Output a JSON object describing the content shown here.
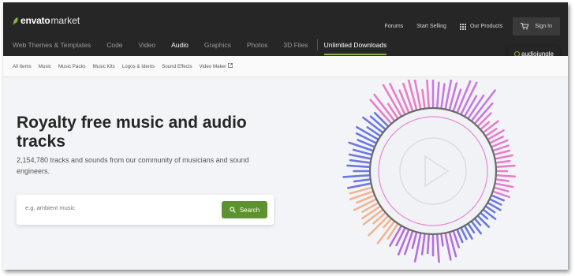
{
  "logo": {
    "brand": "envato",
    "suffix": "market"
  },
  "toplinks": {
    "forums": "Forums",
    "start_selling": "Start Selling",
    "our_products": "Our Products",
    "sign_in": "Sign In"
  },
  "mainnav": {
    "items": [
      "Web Themes & Templates",
      "Code",
      "Video",
      "Audio",
      "Graphics",
      "Photos",
      "3D Files"
    ],
    "active": "Audio",
    "unlimited": "Unlimited Downloads"
  },
  "badge": "audiojungle",
  "subnav": {
    "items": [
      "All Items",
      "Music",
      "Music Packs",
      "Music Kits",
      "Logos & Idents",
      "Sound Effects",
      "Video Maker"
    ]
  },
  "hero": {
    "title": "Royalty free music and audio tracks",
    "subtitle": "2,154,780 tracks and sounds from our community of musicians and sound engineers."
  },
  "search": {
    "placeholder": "e.g. ambient music",
    "button": "Search"
  },
  "colors": {
    "accent": "#82b541",
    "button": "#5d9230",
    "dark": "#262626"
  }
}
